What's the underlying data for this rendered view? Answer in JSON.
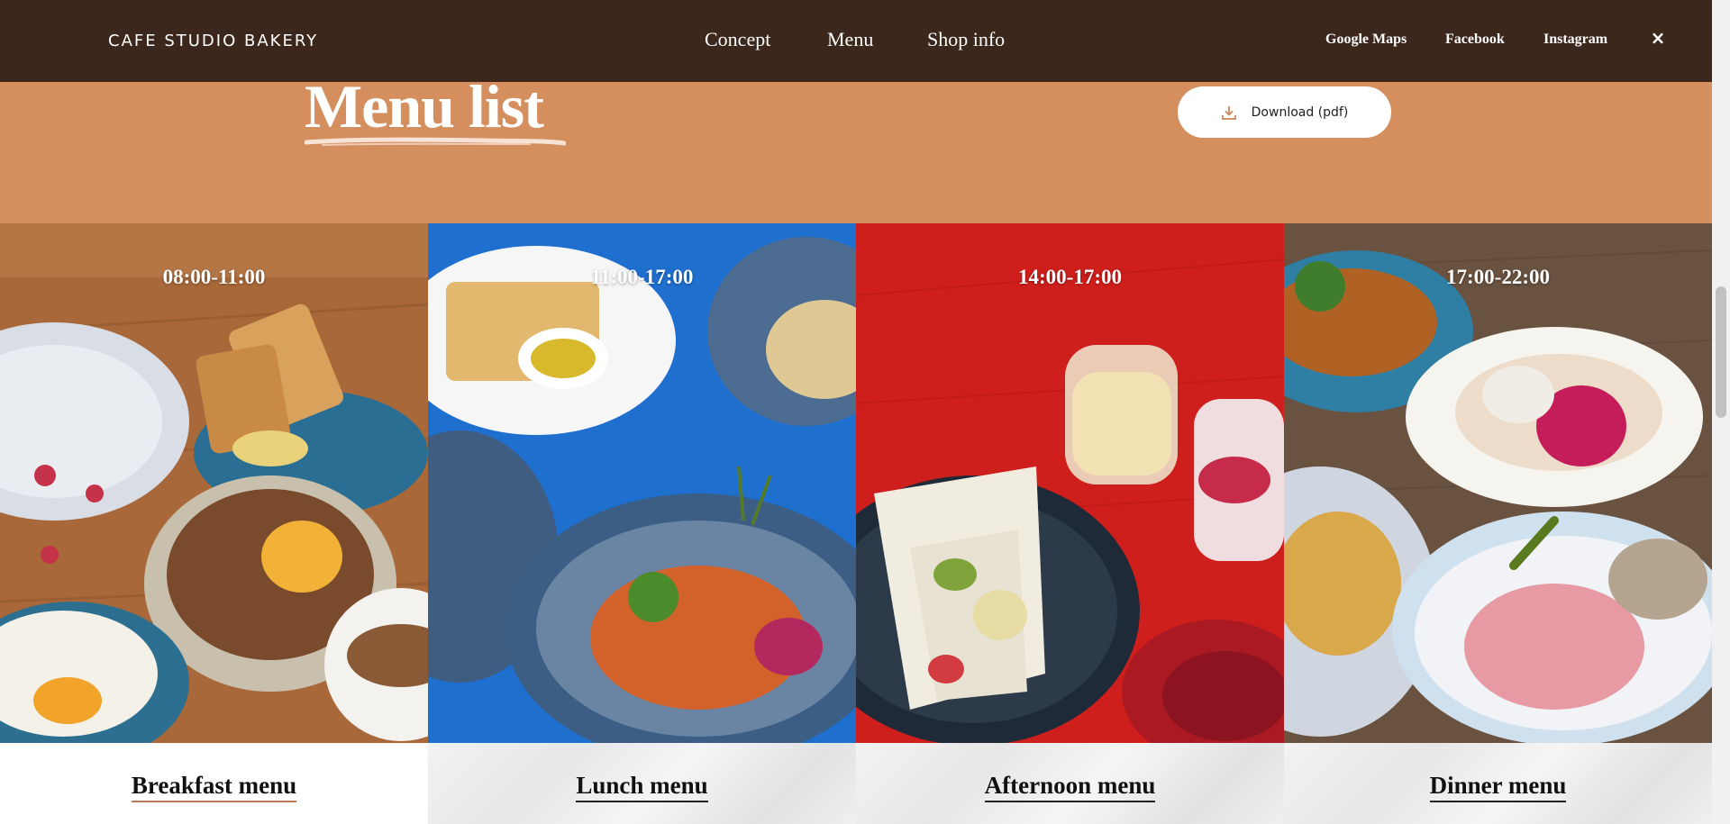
{
  "brand": "CAFE STUDIO BAKERY",
  "nav": {
    "concept": "Concept",
    "menu": "Menu",
    "shop_info": "Shop info"
  },
  "social": {
    "google_maps": "Google Maps",
    "facebook": "Facebook",
    "instagram": "Instagram"
  },
  "close_symbol": "×",
  "header": {
    "title": "Menu list",
    "download_label": "Download (pdf)"
  },
  "panels": [
    {
      "time": "08:00-11:00",
      "label": "Breakfast menu"
    },
    {
      "time": "11:00-17:00",
      "label": "Lunch menu"
    },
    {
      "time": "14:00-17:00",
      "label": "Afternoon menu"
    },
    {
      "time": "17:00-22:00",
      "label": "Dinner menu"
    }
  ],
  "colors": {
    "nav_bg": "#3c271c",
    "header_bg": "#d58f5f",
    "breakfast_bg": "#a8683a",
    "lunch_bg": "#1f6fcf",
    "afternoon_bg": "#cf1f1c",
    "dinner_bg": "#6a5240"
  },
  "icons": {
    "download": "download-icon",
    "close": "close-icon"
  }
}
